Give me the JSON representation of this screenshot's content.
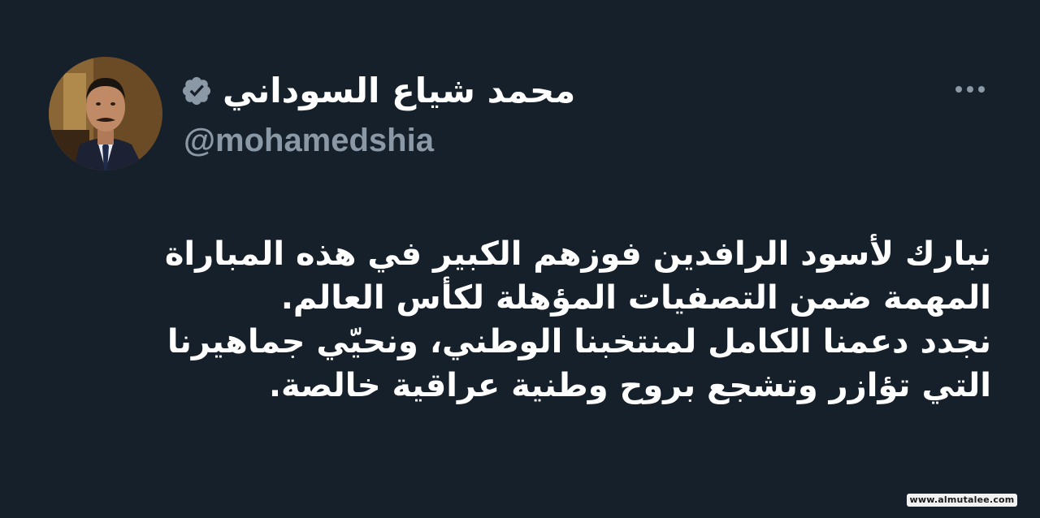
{
  "colors": {
    "background": "#15202b",
    "text_primary": "#ffffff",
    "text_secondary": "#8b98a5",
    "verified_badge": "#8b98a5"
  },
  "author": {
    "display_name": "محمد شياع السوداني",
    "handle": "@mohamedshia",
    "verified": true,
    "verified_icon": "verified-badge-icon",
    "avatar_icon": "profile-photo"
  },
  "menu": {
    "icon": "more-horizontal-icon"
  },
  "tweet": {
    "lines": [
      "نبارك لأسود الرافدين فوزهم الكبير في هذه المباراة",
      "المهمة ضمن التصفيات المؤهلة لكأس العالم.",
      "نجدد دعمنا الكامل لمنتخبنا الوطني، ونحيّي جماهيرنا",
      "التي تؤازر وتشجع بروح وطنية عراقية خالصة."
    ]
  },
  "watermark": {
    "text": "www.almutalee.com"
  }
}
